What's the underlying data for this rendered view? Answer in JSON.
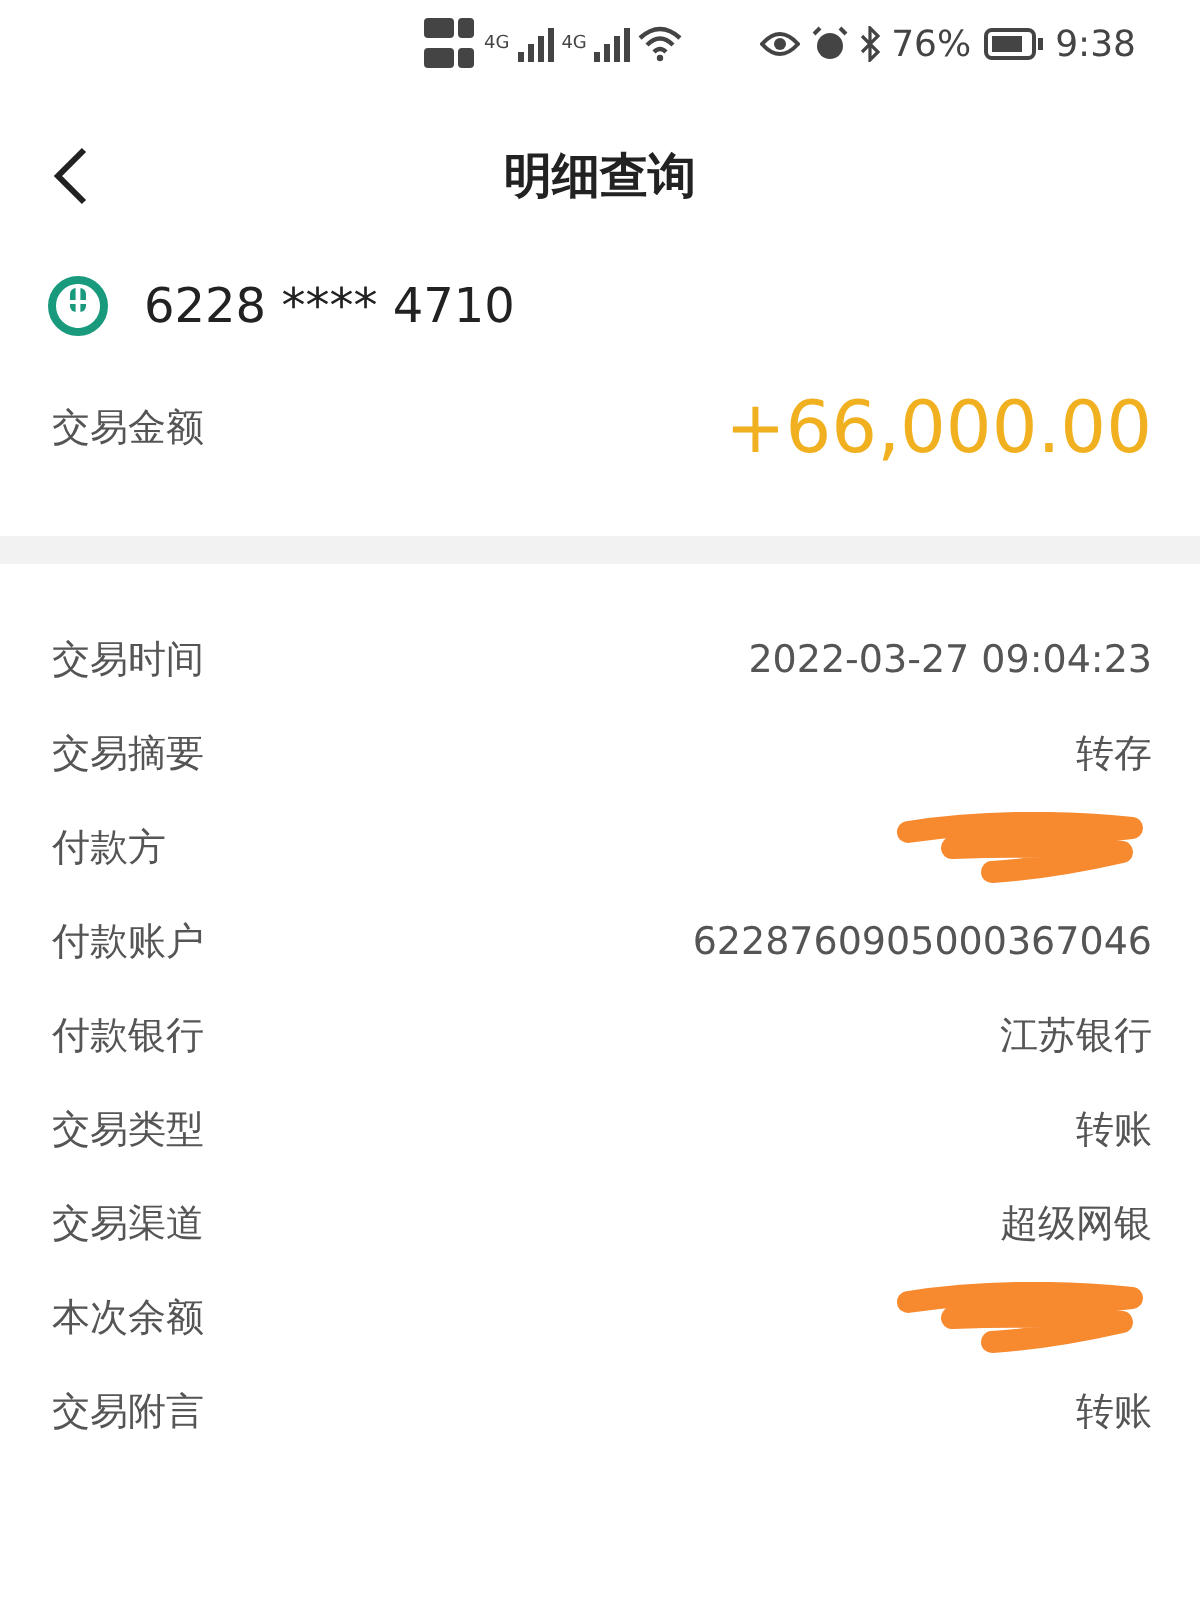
{
  "status_bar": {
    "battery": "76%",
    "time": "9:38",
    "network_labels": [
      "4G",
      "4G"
    ]
  },
  "header": {
    "title": "明细查询"
  },
  "account": {
    "card_number": "6228 **** 4710"
  },
  "amount": {
    "label": "交易金额",
    "value": "+66,000.00"
  },
  "details": [
    {
      "label": "交易时间",
      "value": "2022-03-27 09:04:23",
      "redacted": false
    },
    {
      "label": "交易摘要",
      "value": "转存",
      "redacted": false
    },
    {
      "label": "付款方",
      "redacted": true
    },
    {
      "label": "付款账户",
      "value": "6228760905000367046",
      "redacted": false
    },
    {
      "label": "付款银行",
      "value": "江苏银行",
      "redacted": false
    },
    {
      "label": "交易类型",
      "value": "转账",
      "redacted": false
    },
    {
      "label": "交易渠道",
      "value": "超级网银",
      "redacted": false
    },
    {
      "label": "本次余额",
      "redacted": true
    },
    {
      "label": "交易附言",
      "value": "转账",
      "redacted": false
    }
  ]
}
